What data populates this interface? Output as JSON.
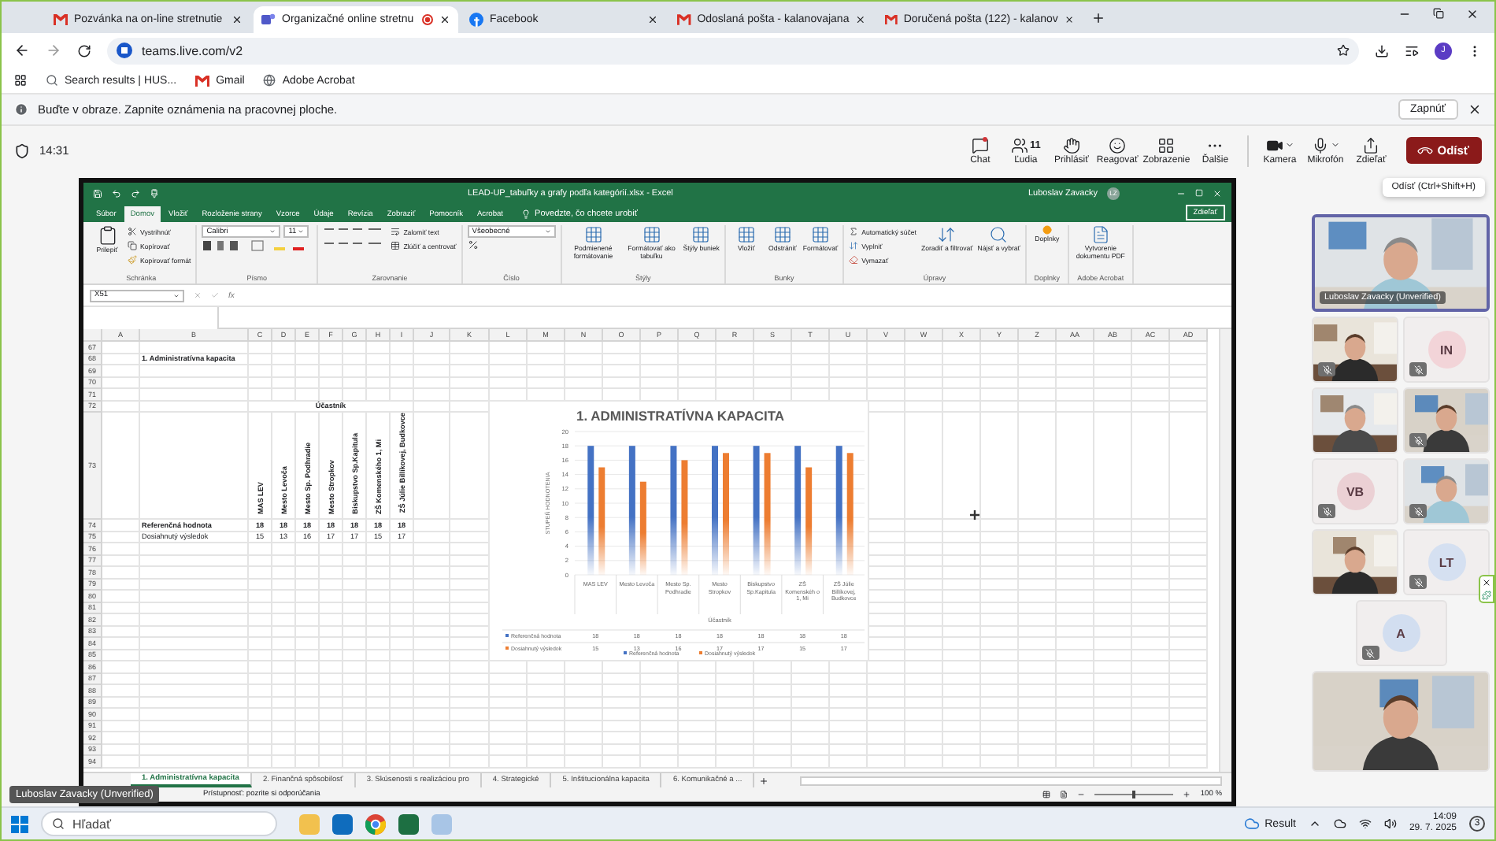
{
  "browser": {
    "tabs": [
      {
        "title": "Pozvánka na on-line stretnutie",
        "kind": "mail",
        "selected": false,
        "recording": false
      },
      {
        "title": "Organizačné online stretnu",
        "kind": "teams",
        "selected": true,
        "recording": true
      },
      {
        "title": "Facebook",
        "kind": "facebook",
        "selected": false,
        "recording": false
      },
      {
        "title": "Odoslaná pošta - kalanovajana",
        "kind": "mail",
        "selected": false,
        "recording": false
      },
      {
        "title": "Doručená pošta (122) - kalanov",
        "kind": "mail",
        "selected": false,
        "recording": false
      }
    ],
    "address": "teams.live.com/v2",
    "profile_initial": "J",
    "bookmarks": [
      {
        "label": "Search results | HUS...",
        "kind": "search"
      },
      {
        "label": "Gmail",
        "kind": "mail"
      },
      {
        "label": "Adobe Acrobat",
        "kind": "globe"
      }
    ]
  },
  "notification": {
    "text": "Buďte v obraze. Zapnite oznámenia na pracovnej ploche.",
    "button": "Zapnúť"
  },
  "meeting": {
    "time": "14:31",
    "actions": [
      {
        "kind": "chat",
        "label": "Chat",
        "badge": true
      },
      {
        "kind": "people",
        "label": "Ľudia",
        "count": "11"
      },
      {
        "kind": "hand",
        "label": "Prihlásiť"
      },
      {
        "kind": "react",
        "label": "Reagovať"
      },
      {
        "kind": "view",
        "label": "Zobrazenie"
      },
      {
        "kind": "more",
        "label": "Ďalšie"
      },
      {
        "kind": "camera",
        "label": "Kamera",
        "menu": true
      },
      {
        "kind": "mic",
        "label": "Mikrofón",
        "menu": true
      },
      {
        "kind": "share",
        "label": "Zdieľať"
      }
    ],
    "leave": "Odísť",
    "tooltip": "Odísť (Ctrl+Shift+H)",
    "presenter_label": "Luboslav Zavacky (Unverified)"
  },
  "excel": {
    "title": "LEAD-UP_tabuľky a grafy podľa kategórií.xlsx - Excel",
    "user": "Luboslav Zavacky",
    "user_initials": "LZ",
    "ribbon_tabs": [
      {
        "label": "Súbor",
        "selected": false
      },
      {
        "label": "Domov",
        "selected": true
      },
      {
        "label": "Vložiť",
        "selected": false
      },
      {
        "label": "Rozloženie strany",
        "selected": false
      },
      {
        "label": "Vzorce",
        "selected": false
      },
      {
        "label": "Údaje",
        "selected": false
      },
      {
        "label": "Revízia",
        "selected": false
      },
      {
        "label": "Zobraziť",
        "selected": false
      },
      {
        "label": "Pomocník",
        "selected": false
      },
      {
        "label": "Acrobat",
        "selected": false
      }
    ],
    "tell_me": "Povedzte, čo chcete urobiť",
    "share": "Zdieľať",
    "groups": [
      {
        "name": "Schránka",
        "kind": "clipboard",
        "big": "Prilepiť",
        "items": [
          "Vystrihnúť",
          "Kopírovať",
          "Kopírovať formát"
        ]
      },
      {
        "name": "Písmo",
        "kind": "font",
        "font": "Calibri",
        "size": "11"
      },
      {
        "name": "Zarovnanie",
        "kind": "align",
        "items": [
          "Zalomiť text",
          "Zlúčiť a centrovať"
        ]
      },
      {
        "name": "Číslo",
        "kind": "number",
        "format": "Všeobecné"
      },
      {
        "name": "Štýly",
        "kind": "bigs",
        "bigs": [
          "Podmienené formátovanie",
          "Formátovať ako tabuľku",
          "Štýly buniek"
        ]
      },
      {
        "name": "Bunky",
        "kind": "bigs",
        "bigs": [
          "Vložiť",
          "Odstrániť",
          "Formátovať"
        ]
      },
      {
        "name": "Úpravy",
        "kind": "editing",
        "items": [
          "Automatický súčet",
          "Vyplniť",
          "Vymazať"
        ],
        "bigs": [
          "Zoradiť a filtrovať",
          "Nájsť a vybrať"
        ]
      },
      {
        "name": "Doplnky",
        "kind": "bigs",
        "bigs": [
          "Doplnky"
        ]
      },
      {
        "name": "Adobe Acrobat",
        "kind": "bigs",
        "bigs": [
          "Vytvorenie dokumentu PDF"
        ]
      }
    ],
    "name_box": "X51",
    "formula_symbol": "fx",
    "columns": [
      "A",
      "B",
      "C",
      "D",
      "E",
      "F",
      "G",
      "H",
      "I",
      "J",
      "K",
      "L",
      "M",
      "N",
      "O",
      "P",
      "Q",
      "R",
      "S",
      "T",
      "U",
      "V",
      "W",
      "X",
      "Y",
      "Z",
      "AA",
      "AB",
      "AC",
      "AD"
    ],
    "rows": [
      "67",
      "68",
      "69",
      "70",
      "71",
      "72",
      "73",
      "74",
      "75",
      "76",
      "77",
      "78",
      "79",
      "80",
      "81",
      "82",
      "83",
      "84",
      "85",
      "86",
      "87",
      "88",
      "89",
      "90",
      "91",
      "92",
      "93",
      "94"
    ],
    "section_title": "1. Administratívna kapacita",
    "group_header": "Účastník",
    "participants": [
      "MAS LEV",
      "Mesto Levoča",
      "Mesto Sp. Podhradie",
      "Mesto Stropkov",
      "Biskupstvo Sp.Kapitula",
      "ZŠ Komenského 1, Mi",
      "ZŠ Júlie Billíkovej, Budkovce"
    ],
    "table_rows": [
      {
        "label": "Referenčná hodnota",
        "bold": true,
        "values": [
          "18",
          "18",
          "18",
          "18",
          "18",
          "18",
          "18"
        ]
      },
      {
        "label": "Dosiahnutý výsledok",
        "bold": false,
        "values": [
          "15",
          "13",
          "16",
          "17",
          "17",
          "15",
          "17"
        ]
      }
    ],
    "chart_data": {
      "type": "bar",
      "title": "1. ADMINISTRATÍVNA KAPACITA",
      "xlabel": "Účastník",
      "ylabel": "STUPEŇ HODNOTENIA",
      "categories": [
        "MAS LEV",
        "Mesto Levoča",
        "Mesto Sp. Podhradie",
        "Mesto Stropkov",
        "Biskupstvo Sp.Kapitula",
        "ZŠ Komenskéh o 1, Mi",
        "ZŠ Júlie Billíkovej, Budkovce"
      ],
      "series": [
        {
          "name": "Referenčná hodnota",
          "color": "#4472c4",
          "values": [
            18,
            18,
            18,
            18,
            18,
            18,
            18
          ]
        },
        {
          "name": "Dosiahnutý výsledok",
          "color": "#ed7d31",
          "values": [
            15,
            13,
            16,
            17,
            17,
            15,
            17
          ]
        }
      ],
      "ylim": [
        0,
        20
      ],
      "yticks": [
        0,
        2,
        4,
        6,
        8,
        10,
        12,
        14,
        16,
        18,
        20
      ],
      "grid": true,
      "legend": true
    },
    "chart_table": [
      {
        "label": "Referenčná hodnota",
        "values": [
          "18",
          "18",
          "18",
          "18",
          "18",
          "18",
          "18"
        ]
      },
      {
        "label": "Dosiahnutý výsledok",
        "values": [
          "15",
          "13",
          "16",
          "17",
          "17",
          "15",
          "17"
        ]
      }
    ],
    "sheet_tabs": [
      {
        "label": "1. Administratívna kapacita",
        "selected": true
      },
      {
        "label": "2. Finančná spôsobilosť",
        "selected": false
      },
      {
        "label": "3. Skúsenosti s realizáciou pro",
        "selected": false
      },
      {
        "label": "4. Strategické",
        "selected": false
      },
      {
        "label": "5. Inštitucionálna kapacita",
        "selected": false
      },
      {
        "label": "6. Komunikačné a ...",
        "selected": false
      }
    ],
    "status": "Prístupnosť: pozrite si odporúčania",
    "zoom": "100 %",
    "zoom_slider": {
      "level": 0.5
    }
  },
  "participants": [
    {
      "kind": "video",
      "name": "Luboslav Zavacky (Unverified)",
      "selected": true,
      "muted": false
    },
    {
      "kind": "video",
      "selected": false,
      "muted": true
    },
    {
      "kind": "initials",
      "initials": "IN",
      "color": "#f2d4d8",
      "selected": false,
      "muted": true
    },
    {
      "kind": "video",
      "selected": false,
      "muted": false
    },
    {
      "kind": "video",
      "selected": false,
      "muted": true
    },
    {
      "kind": "initials",
      "initials": "VB",
      "color": "#ebd0d4",
      "selected": false,
      "muted": true
    },
    {
      "kind": "video",
      "selected": false,
      "muted": true
    },
    {
      "kind": "video",
      "selected": false,
      "muted": false
    },
    {
      "kind": "initials",
      "initials": "LT",
      "color": "#d5e0f1",
      "selected": false,
      "muted": true
    },
    {
      "kind": "initials",
      "initials": "A",
      "color": "#d2def0",
      "selected": false,
      "muted": true
    },
    {
      "kind": "video",
      "selected": false,
      "muted": false
    }
  ],
  "taskbar": {
    "search": "Hľadať",
    "weather": "Result",
    "time": "14:09",
    "date": "29. 7. 2025",
    "notifications": "3"
  }
}
